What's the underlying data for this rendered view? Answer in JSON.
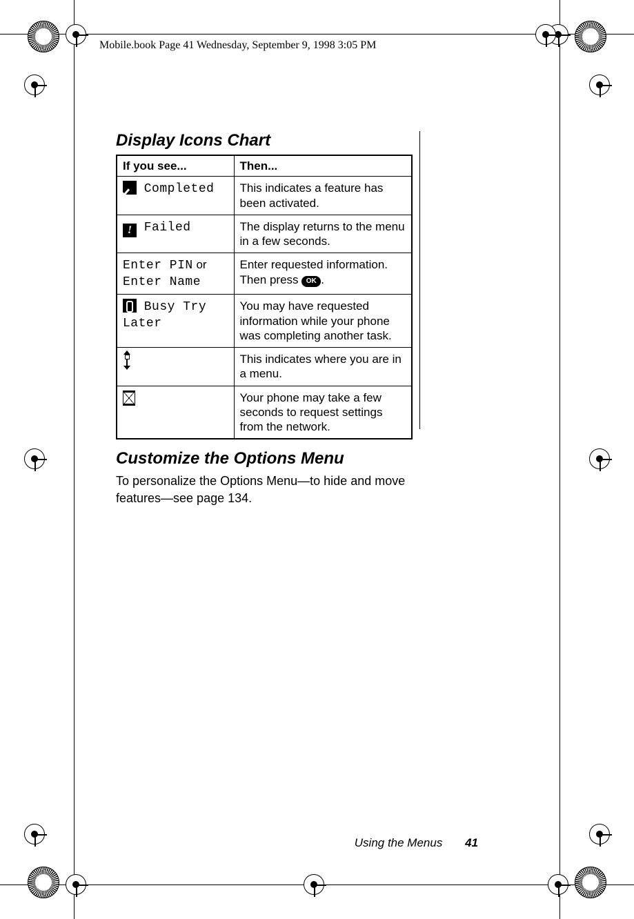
{
  "runhead": "Mobile.book  Page 41  Wednesday, September 9, 1998  3:05 PM",
  "section1_title": "Display Icons Chart",
  "table": {
    "head_if": "If you see...",
    "head_then": "Then...",
    "rows": [
      {
        "icon": "check",
        "lcd": "Completed",
        "then": "This indicates a feature has been activated."
      },
      {
        "icon": "bang",
        "icon_text": "!",
        "lcd": "Failed",
        "then": "The display returns to the menu in a few seconds."
      },
      {
        "lcd_a": "Enter PIN",
        "mid": " or ",
        "lcd_b": "Enter Name",
        "then_pre": "Enter requested information. Then press ",
        "ok": "OK",
        "then_post": "."
      },
      {
        "icon": "phone",
        "lcd": "Busy Try Later",
        "then": "You may have requested information while your phone was completing another task."
      },
      {
        "icon": "scroll",
        "then": "This indicates where you are in a menu."
      },
      {
        "icon": "hourglass",
        "then": "Your phone may take a few seconds to request settings from the network."
      }
    ]
  },
  "section2_title": "Customize the Options Menu",
  "section2_body": "To personalize the Options Menu—to hide and move features—see page 134.",
  "footer_chapter": "Using the Menus",
  "footer_page": "41"
}
